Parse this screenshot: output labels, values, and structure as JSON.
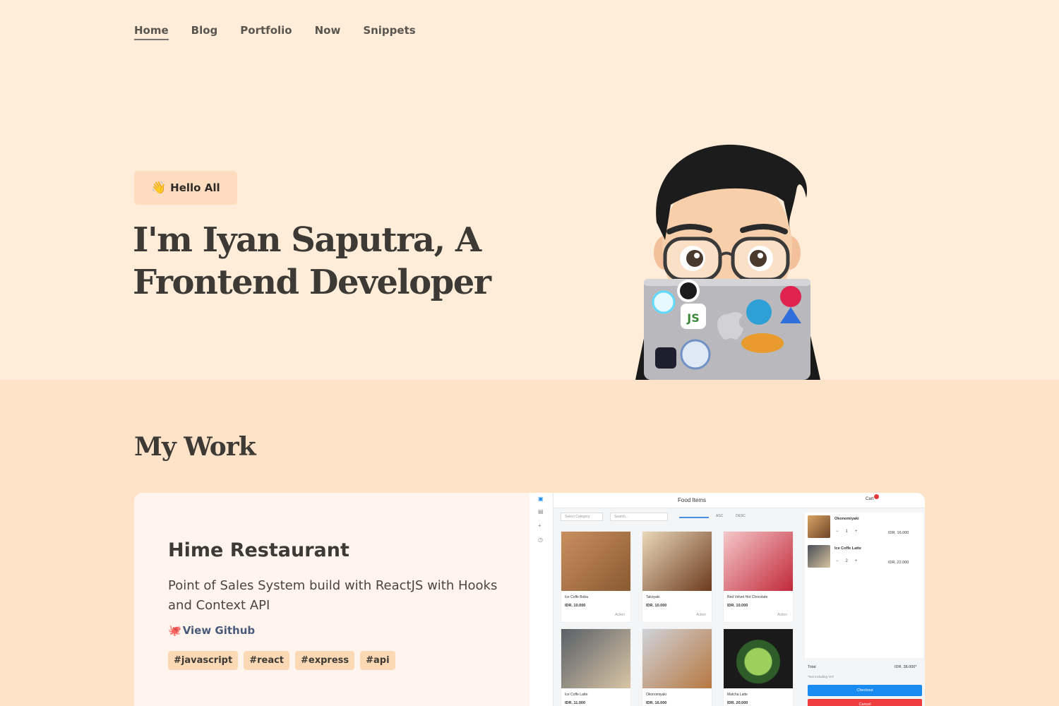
{
  "nav": {
    "items": [
      {
        "label": "Home",
        "active": true
      },
      {
        "label": "Blog"
      },
      {
        "label": "Portfolio"
      },
      {
        "label": "Now"
      },
      {
        "label": "Snippets"
      }
    ]
  },
  "hero": {
    "badge": "Hello All",
    "badge_icon": "waving-hand-icon",
    "headline": "I'm Iyan Saputra, A Frontend Developer"
  },
  "work": {
    "title": "My Work",
    "project": {
      "title": "Hime Restaurant",
      "description": "Point of Sales System build with ReactJS with Hooks and Context API",
      "link_label": "View Github",
      "tags": [
        "#javascript",
        "#react",
        "#express",
        "#api"
      ]
    }
  },
  "screenshot": {
    "header": "Food Items",
    "cart_label": "Cart",
    "category_placeholder": "Select Category",
    "search_placeholder": "Search...",
    "sort": [
      "ASC",
      "DESC"
    ],
    "items": [
      {
        "name": "Ice Coffe Boba",
        "price": "IDR. 10.000",
        "action": "Action"
      },
      {
        "name": "Takoyaki",
        "price": "IDR. 10.000",
        "action": "Action"
      },
      {
        "name": "Red Velvet Hot Chocolate",
        "price": "IDR. 10.000",
        "action": "Action"
      },
      {
        "name": "Ice Coffe Latte",
        "price": "IDR. 11.000"
      },
      {
        "name": "Okonomiyaki",
        "price": "IDR. 16.000"
      },
      {
        "name": "Matcha Latte",
        "price": "IDR. 20.000"
      }
    ],
    "cart": [
      {
        "name": "Okonomiyaki",
        "qty": "1",
        "price": "IDR. 16.000"
      },
      {
        "name": "Ice Coffe Latte",
        "qty": "2",
        "price": "IDR. 22.000"
      }
    ],
    "total_label": "Total",
    "total_value": "IDR. 38.000*",
    "vat_note": "*Not Including VAT",
    "checkout": "Checkout",
    "cancel": "Cancel"
  },
  "colors": {
    "hero_bg": "#ffedd9",
    "work_bg": "#ffe3c9",
    "badge_bg": "#fddcbf",
    "tag_bg": "#fcd9b5",
    "link": "#4a5a7a"
  }
}
